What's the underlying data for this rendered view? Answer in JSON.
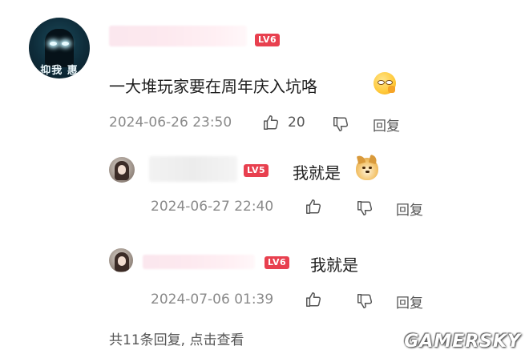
{
  "comments": [
    {
      "level_badge": "LV6",
      "text": "一大堆玩家要在周年庆入坑咯",
      "emoji": "thinking-face-emoji",
      "avatar_text": "抑我 惠",
      "timestamp": "2024-06-26 23:50",
      "like_count": "20",
      "reply_label": "回复"
    }
  ],
  "replies": [
    {
      "level_badge": "LV5",
      "text": "我就是",
      "emoji": "doge-emoji",
      "timestamp": "2024-06-27 22:40",
      "reply_label": "回复"
    },
    {
      "level_badge": "LV6",
      "text": "我就是",
      "timestamp": "2024-07-06 01:39",
      "reply_label": "回复"
    }
  ],
  "more_replies_label": "共11条回复, 点击查看",
  "watermark": "GAMERSKY",
  "colors": {
    "badge": "#e8404f",
    "meta_text": "#8a8a8a",
    "body_text": "#1e1e1e"
  }
}
